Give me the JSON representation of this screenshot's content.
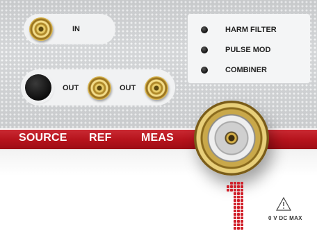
{
  "panel": {
    "in_label": "IN",
    "out_label_1": "OUT",
    "out_label_2": "OUT",
    "indicators": [
      "HARM FILTER",
      "PULSE MOD",
      "COMBINER"
    ],
    "band_labels": [
      "SOURCE",
      "REF",
      "MEAS"
    ],
    "port_number": "1",
    "warning_text": "0 V DC MAX",
    "colors": {
      "band_red": "#b5121b",
      "digit_red": "#d0202a",
      "gold": "#d9b651"
    },
    "icons": [
      "warning-triangle-icon"
    ]
  }
}
